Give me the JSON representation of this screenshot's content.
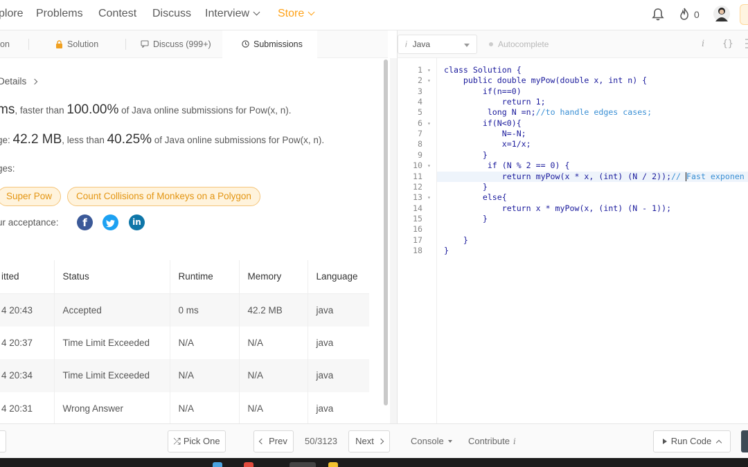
{
  "nav": {
    "items": [
      {
        "label": "plore"
      },
      {
        "label": "Problems"
      },
      {
        "label": "Contest"
      },
      {
        "label": "Discuss"
      },
      {
        "label": "Interview"
      },
      {
        "label": "Store"
      }
    ],
    "streak_count": "0"
  },
  "left_tabs": [
    {
      "label": "on"
    },
    {
      "label": "Solution"
    },
    {
      "label": "Discuss (999+)"
    },
    {
      "label": "Submissions"
    }
  ],
  "details": {
    "link_text": "Details",
    "runtime_prefix": "ms",
    "runtime_mid": ", faster than ",
    "runtime_pct": "100.00%",
    "runtime_suffix": " of Java online submissions for Pow(x, n).",
    "memory_prefix": "ge: ",
    "memory_value": "42.2 MB",
    "memory_mid": ", less than ",
    "memory_pct": "40.25%",
    "memory_suffix": " of Java online submissions for Pow(x, n).",
    "challenges_label": "ges:",
    "challenges": [
      {
        "label": "Super Pow"
      },
      {
        "label": "Count Collisions of Monkeys on a Polygon"
      }
    ],
    "share_label": "ur acceptance:",
    "social": [
      {
        "glyph": "f",
        "color": "#3b5998"
      },
      {
        "glyph": "t",
        "color": "#1da1f2"
      },
      {
        "glyph": "in",
        "color": "#0e76a8"
      }
    ]
  },
  "submissions": {
    "headers": [
      "itted",
      "Status",
      "Runtime",
      "Memory",
      "Language"
    ],
    "rows": [
      {
        "time": "4 20:43",
        "status": "Accepted",
        "runtime": "0 ms",
        "memory": "42.2 MB",
        "language": "java"
      },
      {
        "time": "4 20:37",
        "status": "Time Limit Exceeded",
        "runtime": "N/A",
        "memory": "N/A",
        "language": "java"
      },
      {
        "time": "4 20:34",
        "status": "Time Limit Exceeded",
        "runtime": "N/A",
        "memory": "N/A",
        "language": "java"
      },
      {
        "time": "4 20:31",
        "status": "Wrong Answer",
        "runtime": "N/A",
        "memory": "N/A",
        "language": "java"
      }
    ]
  },
  "editor": {
    "language": "Java",
    "language_icon": "i",
    "autocomplete_label": "Autocomplete",
    "lines": [
      {
        "num": "1",
        "fold": true,
        "code": "class Solution {",
        "comment": ""
      },
      {
        "num": "2",
        "fold": true,
        "code": "    public double myPow(double x, int n) {",
        "comment": ""
      },
      {
        "num": "3",
        "fold": false,
        "code": "        if(n==0)",
        "comment": ""
      },
      {
        "num": "4",
        "fold": false,
        "code": "            return 1;",
        "comment": ""
      },
      {
        "num": "5",
        "fold": false,
        "code": "         long N =n;",
        "comment": "//to handle edges cases;"
      },
      {
        "num": "6",
        "fold": true,
        "code": "        if(N<0){",
        "comment": ""
      },
      {
        "num": "7",
        "fold": false,
        "code": "            N=-N;",
        "comment": ""
      },
      {
        "num": "8",
        "fold": false,
        "code": "            x=1/x;",
        "comment": ""
      },
      {
        "num": "9",
        "fold": false,
        "code": "        }",
        "comment": ""
      },
      {
        "num": "10",
        "fold": true,
        "code": "         if (N % 2 == 0) {",
        "comment": ""
      },
      {
        "num": "11",
        "fold": false,
        "code": "            return myPow(x * x, (int) (N / 2));",
        "comment": "// Fast exponen"
      },
      {
        "num": "12",
        "fold": false,
        "code": "        }",
        "comment": ""
      },
      {
        "num": "13",
        "fold": true,
        "code": "        else{",
        "comment": ""
      },
      {
        "num": "14",
        "fold": false,
        "code": "            return x * myPow(x, (int) (N - 1));",
        "comment": ""
      },
      {
        "num": "15",
        "fold": false,
        "code": "        }",
        "comment": ""
      },
      {
        "num": "16",
        "fold": false,
        "code": "",
        "comment": ""
      },
      {
        "num": "17",
        "fold": false,
        "code": "    }",
        "comment": ""
      },
      {
        "num": "18",
        "fold": false,
        "code": "}",
        "comment": ""
      }
    ],
    "highlighted_line": 11
  },
  "bottom": {
    "pick_one": "Pick One",
    "prev": "Prev",
    "page_count": "50/3123",
    "next": "Next",
    "console": "Console",
    "contribute": "Contribute",
    "run_code": "Run Code"
  },
  "colors": {
    "accent": "#ffa116",
    "accepted": "#2aa189",
    "failed": "#d9363e"
  }
}
